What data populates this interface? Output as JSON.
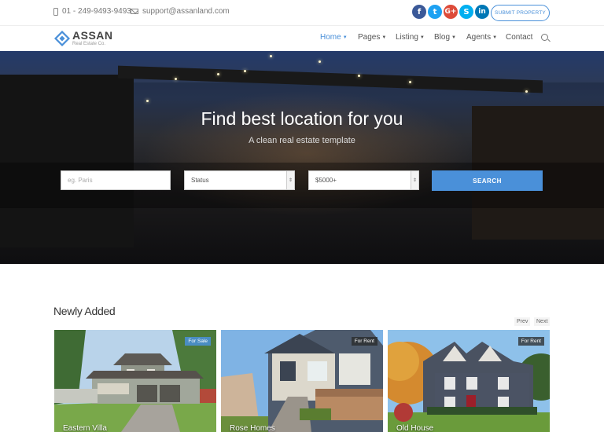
{
  "topbar": {
    "phone": "01 - 249-9493-9493",
    "email": "support@assanland.com",
    "submit_label": "SUBMIT PROPERTY",
    "social": [
      {
        "icon": "facebook-icon",
        "glyph": "f",
        "color": "#3b5998"
      },
      {
        "icon": "twitter-icon",
        "glyph": "t",
        "color": "#1da1f2"
      },
      {
        "icon": "google-plus-icon",
        "glyph": "G+",
        "color": "#dd4b39"
      },
      {
        "icon": "skype-icon",
        "glyph": "S",
        "color": "#00aff0"
      },
      {
        "icon": "linkedin-icon",
        "glyph": "in",
        "color": "#0077b5"
      }
    ]
  },
  "brand": {
    "name": "ASSAN",
    "tagline": "Real Estate Co.",
    "accent": "#4a90d9"
  },
  "nav": {
    "items": [
      {
        "label": "Home",
        "active": true,
        "dropdown": true
      },
      {
        "label": "Pages",
        "dropdown": true
      },
      {
        "label": "Listing",
        "dropdown": true
      },
      {
        "label": "Blog",
        "dropdown": true
      },
      {
        "label": "Agents",
        "dropdown": true
      },
      {
        "label": "Contact",
        "dropdown": false
      }
    ]
  },
  "hero": {
    "title": "Find best location for you",
    "subtitle": "A clean real estate template",
    "search": {
      "location_placeholder": "eg. Paris",
      "status_value": "Status",
      "price_value": "$5000+",
      "button_label": "SEARCH"
    }
  },
  "listings": {
    "title": "Newly Added",
    "prev_label": "Prev",
    "next_label": "Next",
    "cards": [
      {
        "name": "Eastern Villa",
        "badge": "For Sale"
      },
      {
        "name": "Rose Homes",
        "badge": "For Rent"
      },
      {
        "name": "Old House",
        "badge": "For Rent"
      }
    ]
  }
}
